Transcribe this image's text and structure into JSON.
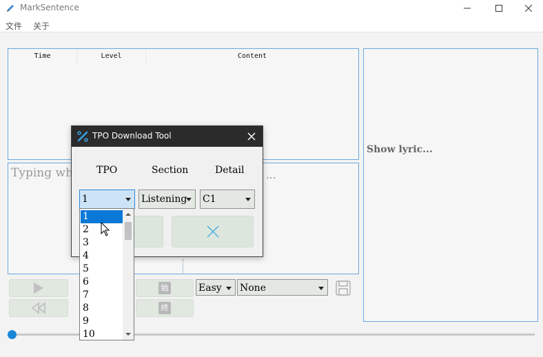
{
  "window": {
    "title": "MarkSentence"
  },
  "menu": {
    "items": [
      "文件",
      "关于"
    ]
  },
  "table": {
    "headers": [
      "Time",
      "Level",
      "Content"
    ]
  },
  "editor": {
    "placeholder_visible": "Typing wh",
    "ellipsis": "..."
  },
  "lyric": {
    "label": "Show lyric..."
  },
  "controls": {
    "start_label": "始",
    "end_label": "终",
    "difficulty": {
      "value": "Easy"
    },
    "mode": {
      "value": "None"
    }
  },
  "dialog": {
    "title": "TPO Download Tool",
    "labels": {
      "tpo": "TPO",
      "section": "Section",
      "detail": "Detail"
    },
    "tpo_value": "1",
    "section_value": "Listening",
    "detail_value": "C1"
  },
  "dropdown": {
    "options": [
      "1",
      "2",
      "3",
      "4",
      "5",
      "6",
      "7",
      "8",
      "9",
      "10"
    ],
    "selected_index": 0
  },
  "colors": {
    "accent": "#0a78d7",
    "panel_border": "#6aa8e0",
    "dialog_title": "#2b2b2b"
  }
}
